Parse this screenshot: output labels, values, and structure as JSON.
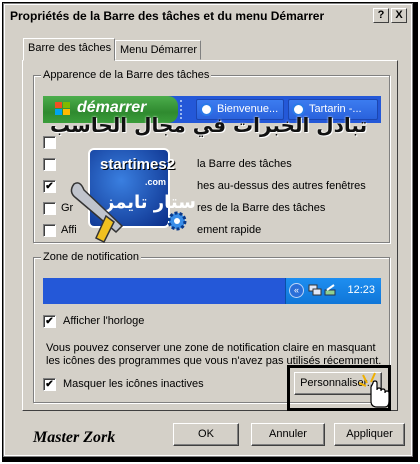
{
  "window": {
    "title": "Propriétés de la Barre des tâches et du menu Démarrer",
    "help_label": "?",
    "close_label": "X"
  },
  "tabs": [
    {
      "label": "Barre des tâches",
      "active": true
    },
    {
      "label": "Menu Démarrer",
      "active": false
    }
  ],
  "taskbar_group": {
    "legend": "Apparence de la Barre des tâches",
    "start_label": "démarrer",
    "task_buttons": [
      "Bienvenue...",
      "Tartarin -..."
    ],
    "options": [
      {
        "label": "",
        "checked": false
      },
      {
        "label": "la Barre des tâches",
        "checked": false
      },
      {
        "label": "hes au-dessus des autres fenêtres",
        "checked": true
      },
      {
        "label": "res de la Barre des tâches",
        "checked": false
      },
      {
        "label": "ement rapide",
        "checked": false
      }
    ],
    "partial_prefixes": [
      "Gr",
      "Affi"
    ]
  },
  "notif_group": {
    "legend": "Zone de notification",
    "tray_arrow": "«",
    "clock": "12:23",
    "show_clock_label": "Afficher l'horloge",
    "show_clock_checked": true,
    "description": "Vous pouvez conserver une zone de notification claire en masquant les icônes des programmes que vous n'avez pas utilisés récemment.",
    "hide_inactive_label": "Masquer les icônes inactives",
    "hide_inactive_checked": true,
    "customize_label": "Personnaliser..."
  },
  "buttons": {
    "ok": "OK",
    "cancel": "Annuler",
    "apply": "Appliquer"
  },
  "signature": "Master Zork",
  "watermark": {
    "arabic_line": "تبادل الخبرات في مجال الحاسب",
    "site": "startimes2",
    "com": ".com",
    "arabic_name": "ستار تايمز"
  },
  "colors": {
    "window_bg": "#d4d0c8",
    "taskbar_blue": "#2458d8",
    "start_green": "#3a9d3a",
    "tray_blue": "#0f76d8"
  }
}
